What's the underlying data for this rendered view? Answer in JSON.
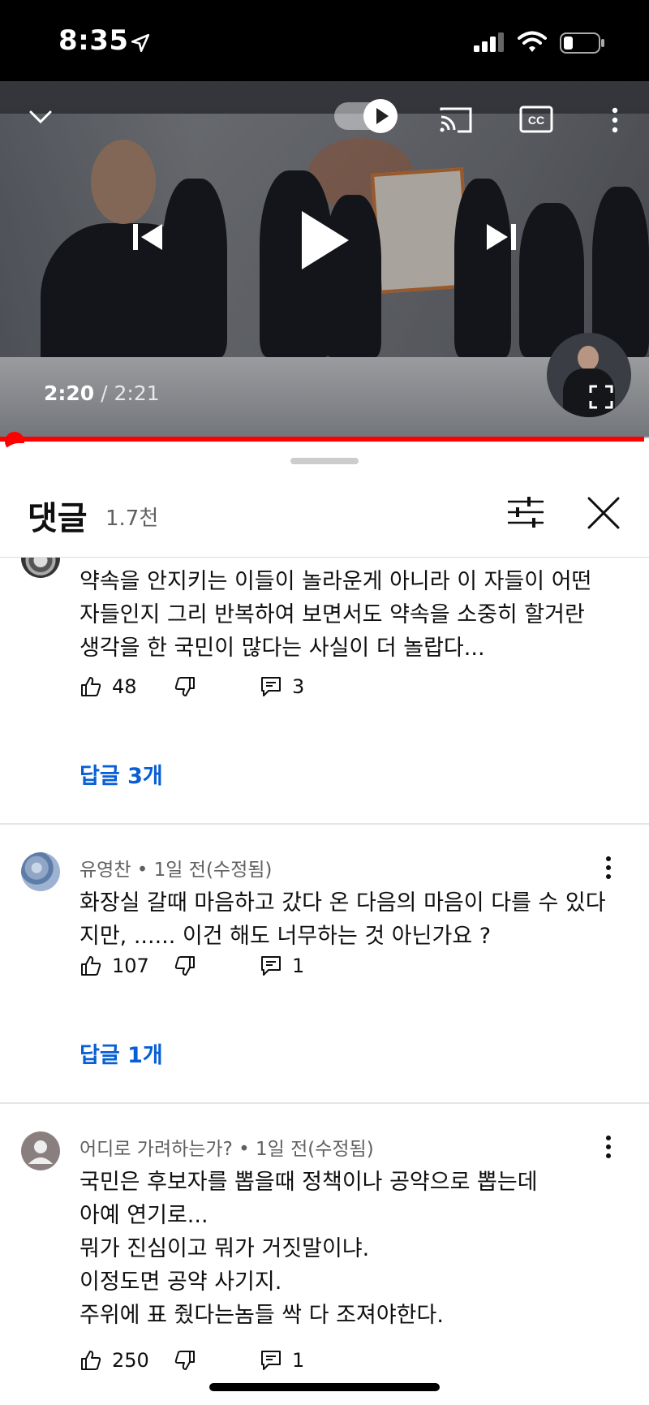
{
  "status_bar": {
    "time": "8:35"
  },
  "video": {
    "current_time": "2:20",
    "duration_text": " / 2:21",
    "progress": 0.993
  },
  "comments_panel": {
    "title": "댓글",
    "count": "1.7천",
    "comments": [
      {
        "text": "약속을 안지키는 이들이 놀라운게 아니라 이 자들이 어떤\n자들인지 그리 반복하여 보면서도 약속을 소중히 할거란\n생각을 한 국민이 많다는 사실이 더 놀랍다...",
        "likes": "48",
        "reply_count": "3",
        "replies_label": "답글 3개"
      },
      {
        "author": "유영찬",
        "time": "• 1일 전(수정됨)",
        "text": "화장실 갈때 마음하고 갔다 온 다음의 마음이 다를 수 있다\n지만, ...... 이건 해도 너무하는 것 아닌가요 ?",
        "likes": "107",
        "reply_count": "1",
        "replies_label": "답글 1개"
      },
      {
        "author": "어디로 가려하는가?",
        "time": "• 1일 전(수정됨)",
        "text": "국민은 후보자를 뽑을때 정책이나 공약으로 뽑는데\n아예 연기로...\n뭐가 진심이고 뭐가 거짓말이냐.\n이정도면 공약 사기지.\n주위에 표 줬다는놈들 싹 다 조져야한다.",
        "likes": "250",
        "reply_count": "1"
      }
    ]
  }
}
